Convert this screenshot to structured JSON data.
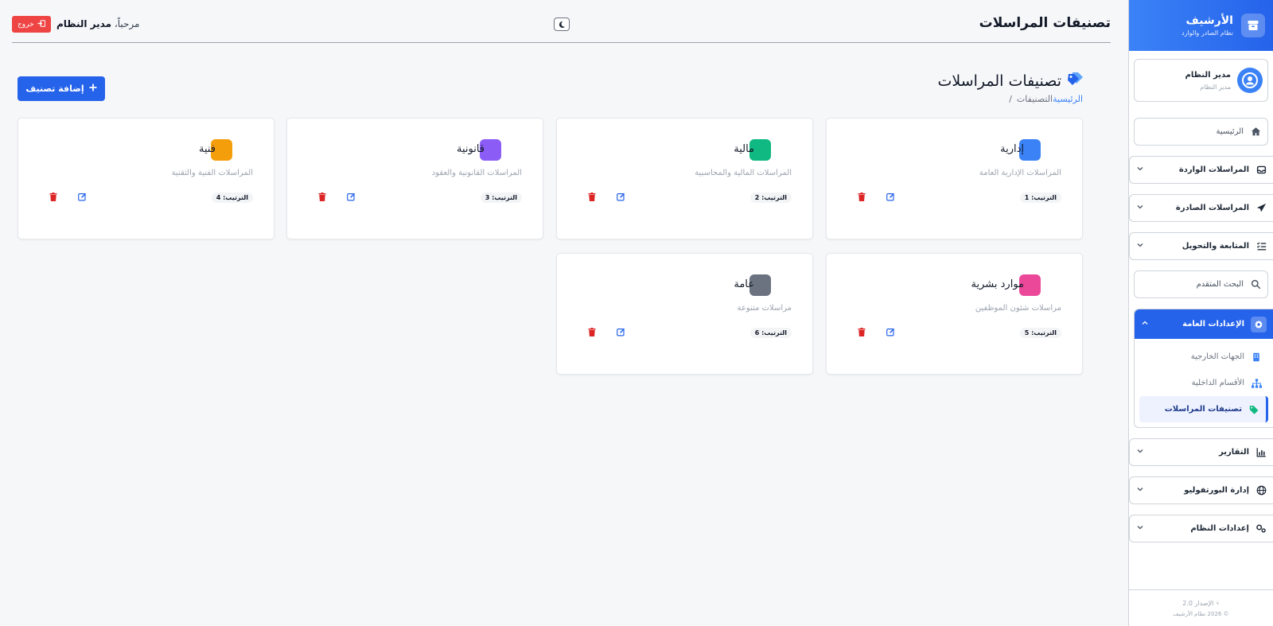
{
  "brand": {
    "title": "الأرشيف",
    "subtitle": "نظام الصادر والوارد"
  },
  "user": {
    "name": "مدير النظام",
    "role": "مدير النظام"
  },
  "nav": {
    "home": "الرئيسية",
    "incoming": "المراسلات الواردة",
    "outgoing": "المراسلات الصادرة",
    "followup": "المتابعة والتحويل",
    "search": "البحث المتقدم",
    "settings": "الإعدادات العامة",
    "external": "الجهات الخارجية",
    "internal": "الأقسام الداخلية",
    "categories": "تصنيفات المراسلات",
    "reports": "التقارير",
    "portfolio": "إدارة البورتفوليو",
    "system": "إعدادات النظام"
  },
  "footer": {
    "version": "الإصدار 2.0",
    "copyright": "© 2026 نظام الأرشيف"
  },
  "header": {
    "title": "تصنيفات المراسلات",
    "welcome": "مرحباً،",
    "welcome_name": "مدير النظام",
    "logout": "خروج"
  },
  "page": {
    "title": "تصنيفات المراسلات",
    "breadcrumb_home": "الرئيسية",
    "breadcrumb_current": "التصنيفات",
    "breadcrumb_sep": "/",
    "add_button": "إضافة تصنيف"
  },
  "categories": [
    {
      "name": "إدارية",
      "description": "المراسلات الإدارية العامة",
      "order": "الترتيب: 1",
      "color": "#3b82f6"
    },
    {
      "name": "مالية",
      "description": "المراسلات المالية والمحاسبية",
      "order": "الترتيب: 2",
      "color": "#10b981"
    },
    {
      "name": "قانونية",
      "description": "المراسلات القانونية والعقود",
      "order": "الترتيب: 3",
      "color": "#8b5cf6"
    },
    {
      "name": "فنية",
      "description": "المراسلات الفنية والتقنية",
      "order": "الترتيب: 4",
      "color": "#f59e0b"
    },
    {
      "name": "موارد بشرية",
      "description": "مراسلات شئون الموظفين",
      "order": "الترتيب: 5",
      "color": "#ec4899"
    },
    {
      "name": "عامة",
      "description": "مراسلات متنوعة",
      "order": "الترتيب: 6",
      "color": "#6b7280"
    }
  ]
}
